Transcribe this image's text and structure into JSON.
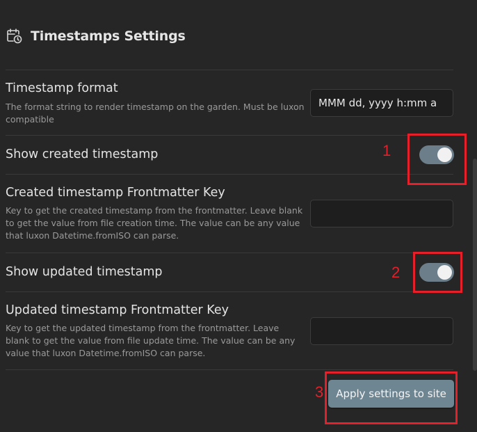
{
  "header": {
    "title": "Timestamps Settings",
    "icon": "calendar-clock-icon"
  },
  "settings": {
    "format": {
      "name": "Timestamp format",
      "desc": "The format string to render timestamp on the garden. Must be luxon compatible",
      "value": "MMM dd, yyyy h:mm a"
    },
    "show_created": {
      "name": "Show created timestamp",
      "enabled": true
    },
    "created_key": {
      "name": "Created timestamp Frontmatter Key",
      "desc": "Key to get the created timestamp from the frontmatter. Leave blank to get the value from file creation time. The value can be any value that luxon Datetime.fromISO can parse.",
      "value": ""
    },
    "show_updated": {
      "name": "Show updated timestamp",
      "enabled": true
    },
    "updated_key": {
      "name": "Updated timestamp Frontmatter Key",
      "desc": "Key to get the updated timestamp from the frontmatter. Leave blank to get the value from file update time. The value can be any value that luxon Datetime.fromISO can parse.",
      "value": ""
    }
  },
  "apply_button": {
    "label": "Apply settings to site"
  },
  "annotations": {
    "one": "1",
    "two": "2",
    "three": "3"
  },
  "colors": {
    "accent": "#6b7e8a",
    "annotation": "#e5202a",
    "background": "#262626"
  }
}
